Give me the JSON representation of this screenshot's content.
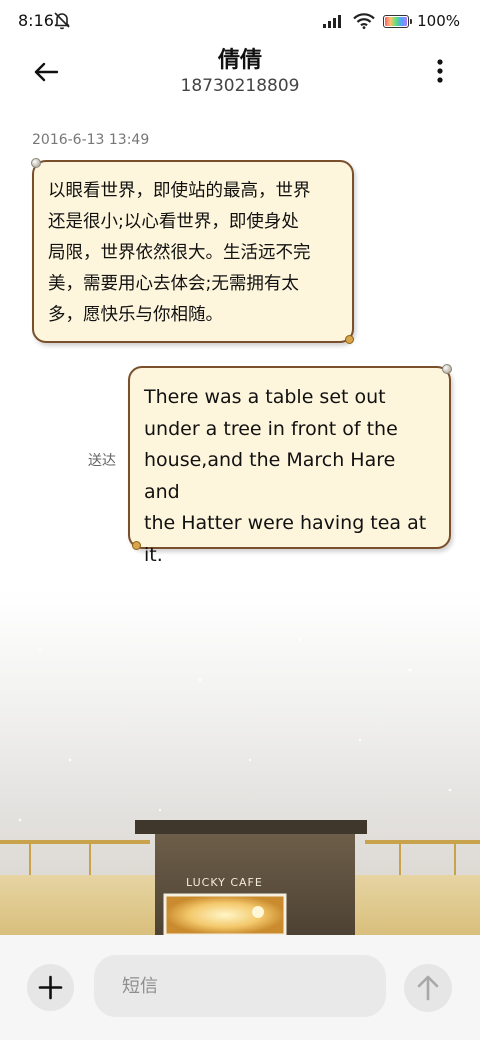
{
  "status_bar": {
    "time": "8:16",
    "battery_percent": "100%",
    "icons": [
      "bell-off-icon",
      "signal-icon",
      "wifi-icon",
      "battery-icon"
    ]
  },
  "header": {
    "contact_name": "倩倩",
    "phone_number": "18730218809",
    "icons": [
      "back-arrow-icon",
      "more-vertical-icon"
    ]
  },
  "conversation": {
    "timestamp": "2016-6-13 13:49",
    "messages": [
      {
        "direction": "incoming",
        "lines": [
          "以眼看世界，即使站的最高，世界",
          "还是很小;以心看世界，即使身处",
          "局限，世界依然很大。生活远不完",
          "美，需要用心去体会;无需拥有太",
          "多，愿快乐与你相随。"
        ]
      },
      {
        "direction": "outgoing",
        "status": "送达",
        "lines": [
          "There was a table set out",
          "under a tree in front of the",
          "house,and the March Hare and",
          "the Hatter were having tea at",
          "it."
        ]
      }
    ],
    "background_sign": "LUCKY CAFE"
  },
  "composer": {
    "placeholder": "短信",
    "value": "",
    "icons": [
      "plus-icon",
      "send-arrow-icon"
    ]
  },
  "colors": {
    "bubble_fill": "#fdf5dc",
    "bubble_border": "#7a4f2c",
    "composer_bg": "#f6f6f6",
    "button_bg": "#e6e6e6"
  }
}
